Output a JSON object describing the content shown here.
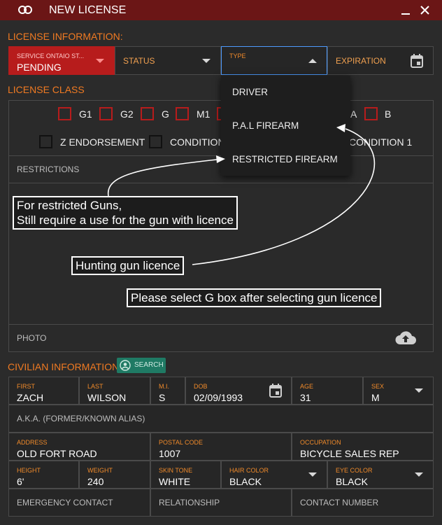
{
  "window": {
    "title": "NEW LICENSE"
  },
  "license_info": {
    "section_label": "LICENSE INFORMATION:",
    "service": {
      "label": "SERVICE ONTAIO ST...",
      "value": "PENDING"
    },
    "status": {
      "placeholder": "STATUS"
    },
    "type": {
      "label": "TYPE",
      "options": [
        "DRIVER",
        "P.A.L FIREARM",
        "RESTRICTED FIREARM"
      ]
    },
    "expiration": {
      "placeholder": "EXPIRATION"
    }
  },
  "license_class": {
    "section_label": "LICENSE CLASS",
    "row1": [
      "G1",
      "G2",
      "G",
      "M1",
      "A",
      "B"
    ],
    "row2": [
      "Z ENDORSEMENT",
      "CONDITION",
      "CONDITION 1"
    ],
    "restrictions_label": "RESTRICTIONS",
    "photo_label": "PHOTO"
  },
  "annotations": {
    "restricted_line1": "For restricted Guns,",
    "restricted_line2": "Still require a use for the gun with licence",
    "hunting": "Hunting gun licence",
    "select_g": "Please select G box after selecting gun licence"
  },
  "civilian": {
    "section_label": "CIVILIAN INFORMATION",
    "search_label": "SEARCH",
    "first": {
      "label": "FIRST",
      "value": "ZACH"
    },
    "last": {
      "label": "LAST",
      "value": "WILSON"
    },
    "mi": {
      "label": "M.I.",
      "value": "S"
    },
    "dob": {
      "label": "DOB",
      "value": "02/09/1993"
    },
    "age": {
      "label": "AGE",
      "value": "31"
    },
    "sex": {
      "label": "SEX",
      "value": "M"
    },
    "aka_placeholder": "A.K.A. (FORMER/KNOWN ALIAS)",
    "address": {
      "label": "ADDRESS",
      "value": "OLD FORT ROAD"
    },
    "postal": {
      "label": "POSTAL CODE",
      "value": "1007"
    },
    "occupation": {
      "label": "OCCUPATION",
      "value": "BICYCLE SALES REP"
    },
    "height": {
      "label": "HEIGHT",
      "value": "6'"
    },
    "weight": {
      "label": "WEIGHT",
      "value": "240"
    },
    "skin": {
      "label": "SKIN TONE",
      "value": "WHITE"
    },
    "hair": {
      "label": "HAIR COLOR",
      "value": "BLACK"
    },
    "eye": {
      "label": "EYE COLOR",
      "value": "BLACK"
    },
    "emergency_placeholder": "EMERGENCY CONTACT",
    "relationship_placeholder": "RELATIONSHIP",
    "contact_placeholder": "CONTACT NUMBER"
  },
  "colors": {
    "titlebar": "#6b1616",
    "accent": "#f07a22",
    "error": "#b71c1c",
    "focus": "#4d9bff",
    "search": "#1f7a64"
  }
}
